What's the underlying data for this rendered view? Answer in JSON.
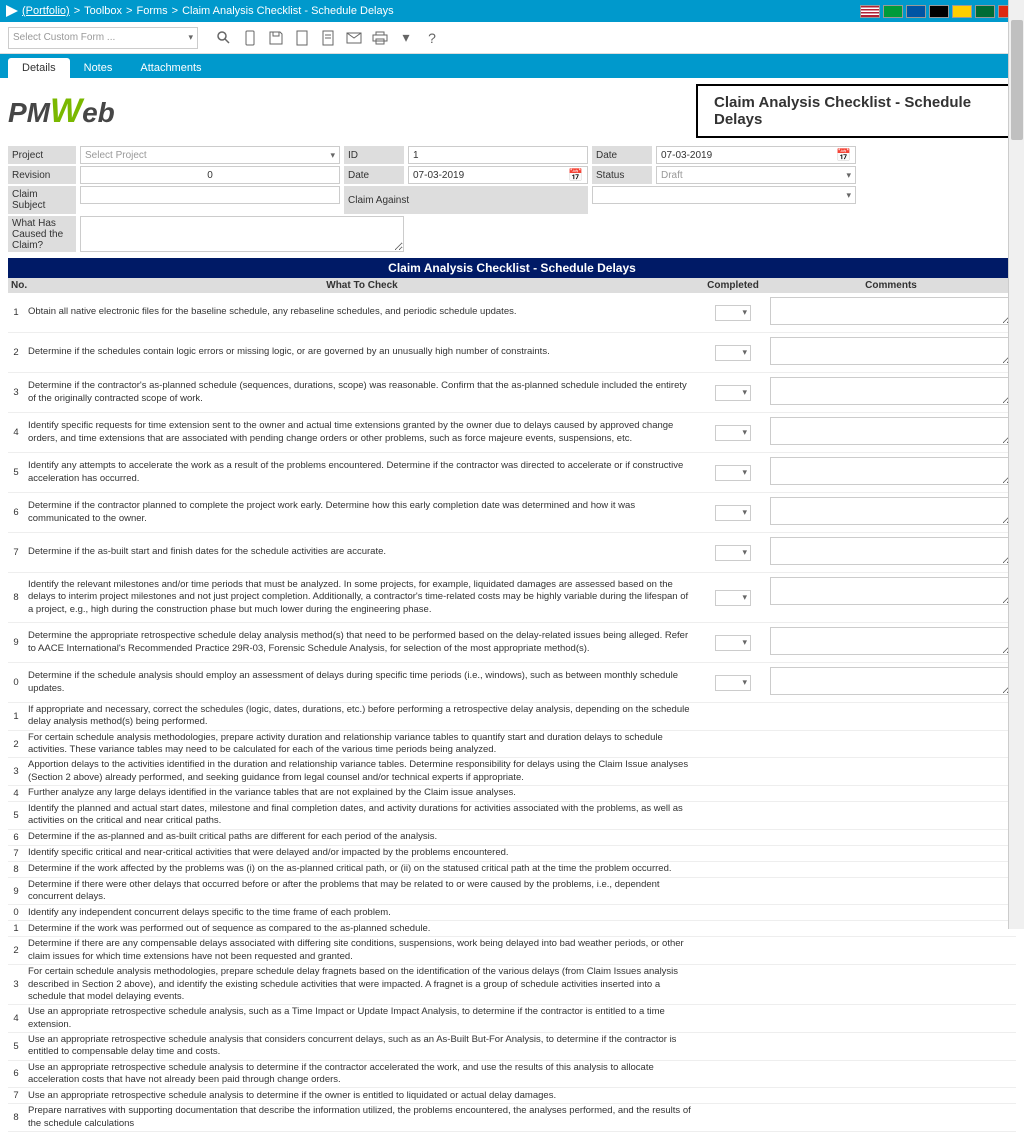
{
  "breadcrumb": {
    "portfolio": "(Portfolio)",
    "sep": ">",
    "toolbox": "Toolbox",
    "forms": "Forms",
    "current": "Claim Analysis Checklist - Schedule Delays"
  },
  "custom_form_placeholder": "Select Custom Form ...",
  "tabs": {
    "details": "Details",
    "notes": "Notes",
    "attachments": "Attachments"
  },
  "logo": {
    "pm": "PM",
    "w": "W",
    "eb": "eb"
  },
  "page_title": "Claim Analysis Checklist - Schedule Delays",
  "form": {
    "project_label": "Project",
    "project_value": "Select Project",
    "revision_label": "Revision",
    "revision_value": "0",
    "claim_subject_label": "Claim Subject",
    "what_caused_label": "What Has Caused the Claim?",
    "id_label": "ID",
    "id_value": "1",
    "date_label": "Date",
    "date_value": "07-03-2019",
    "date2_label": "Date",
    "date2_value": "07-03-2019",
    "claim_against_label": "Claim Against",
    "status_label": "Status",
    "status_value": "Draft"
  },
  "section_title": "Claim Analysis Checklist - Schedule Delays",
  "columns": {
    "no": "No.",
    "what": "What To Check",
    "completed": "Completed",
    "comments": "Comments"
  },
  "rows": [
    {
      "no": "1",
      "text": "Obtain all native electronic files for the baseline schedule, any rebaseline schedules, and periodic schedule updates.",
      "dd": true,
      "cm": true
    },
    {
      "no": "2",
      "text": "Determine if the schedules contain logic errors or missing logic, or are governed by an unusually high number of constraints.",
      "dd": true,
      "cm": true
    },
    {
      "no": "3",
      "text": "Determine if the contractor's as-planned schedule (sequences, durations, scope) was reasonable. Confirm that the as-planned schedule included the entirety of the originally contracted scope of work.",
      "dd": true,
      "cm": true
    },
    {
      "no": "4",
      "text": "Identify specific requests for time extension sent to the owner and actual time extensions granted by the owner due to delays caused by approved change orders, and time extensions that are associated with pending change orders or other problems, such as force majeure events, suspensions, etc.",
      "dd": true,
      "cm": true
    },
    {
      "no": "5",
      "text": "Identify any attempts to accelerate the work as a result of the problems encountered. Determine if the contractor was directed to accelerate or if constructive acceleration has occurred.",
      "dd": true,
      "cm": true
    },
    {
      "no": "6",
      "text": "Determine if the contractor planned to complete the project work early. Determine how this early completion date was determined and how it was communicated to the owner.",
      "dd": true,
      "cm": true
    },
    {
      "no": "7",
      "text": "Determine if the as-built start and finish dates for the schedule activities are accurate.",
      "dd": true,
      "cm": true
    },
    {
      "no": "8",
      "text": "Identify the relevant milestones and/or time periods that must be analyzed. In some projects, for example, liquidated damages are assessed based on the delays to interim project milestones and not just project completion. Additionally, a contractor's time-related costs may be highly variable during the lifespan of a project, e.g., high during the construction phase but much lower during the engineering phase.",
      "dd": true,
      "cm": true
    },
    {
      "no": "9",
      "text": "Determine the appropriate retrospective schedule delay analysis method(s) that need to be performed based on the delay-related issues being alleged. Refer to AACE International's Recommended Practice 29R-03, Forensic Schedule Analysis, for selection of the most appropriate method(s).",
      "dd": true,
      "cm": true
    },
    {
      "no": "0",
      "text": "Determine if the schedule analysis should employ an assessment of delays during specific time periods (i.e., windows), such as between monthly schedule updates.",
      "dd": true,
      "cm": true
    },
    {
      "no": "1",
      "text": "If appropriate and necessary, correct the schedules (logic, dates, durations, etc.) before performing a retrospective delay analysis, depending on the schedule delay analysis method(s) being performed.",
      "compact": true
    },
    {
      "no": "2",
      "text": "For certain schedule analysis methodologies, prepare activity duration and relationship variance tables to quantify start and duration delays to schedule activities. These variance tables may need to be calculated for each of the various time periods being analyzed.",
      "compact": true
    },
    {
      "no": "3",
      "text": "Apportion delays to the activities identified in the duration and relationship variance tables. Determine responsibility for delays using the Claim Issue analyses (Section 2 above) already performed, and seeking guidance from legal counsel and/or technical experts if appropriate.",
      "compact": true
    },
    {
      "no": "4",
      "text": "Further analyze any large delays identified in the variance tables that are not explained by the Claim issue analyses.",
      "compact": true
    },
    {
      "no": "5",
      "text": "Identify the planned and actual start dates, milestone and final completion dates, and activity durations for activities associated with the problems, as well as activities on the critical and near critical paths.",
      "compact": true
    },
    {
      "no": "6",
      "text": "Determine if the as-planned and as-built critical paths are different for each period of the analysis.",
      "compact": true
    },
    {
      "no": "7",
      "text": "Identify specific critical and near-critical activities that were delayed and/or impacted by the problems encountered.",
      "compact": true
    },
    {
      "no": "8",
      "text": "Determine if the work affected by the problems was (i) on the as-planned critical path, or (ii) on the statused critical path at the time the problem occurred.",
      "compact": true
    },
    {
      "no": "9",
      "text": "Determine if there were other delays that occurred before or after the problems that may be related to or were caused by the problems, i.e., dependent concurrent delays.",
      "compact": true
    },
    {
      "no": "0",
      "text": "Identify any independent concurrent delays specific to the time frame of each problem.",
      "compact": true
    },
    {
      "no": "1",
      "text": "Determine if the work was performed out of sequence as compared to the as-planned schedule.",
      "compact": true
    },
    {
      "no": "2",
      "text": "Determine if there are any compensable delays associated with differing site conditions, suspensions, work being delayed into bad weather periods, or other claim issues for which time extensions have not been requested and granted.",
      "compact": true
    },
    {
      "no": "3",
      "text": "For certain schedule analysis methodologies, prepare schedule delay fragnets based on the identification of the various delays (from Claim Issues analysis described in Section 2 above), and identify the existing schedule activities that were impacted. A fragnet is a group of schedule activities inserted into a schedule that model delaying events.",
      "compact": true
    },
    {
      "no": "4",
      "text": "Use an appropriate retrospective schedule analysis, such as a Time Impact or Update Impact Analysis, to determine if the contractor is entitled to a time extension.",
      "compact": true
    },
    {
      "no": "5",
      "text": "Use an appropriate retrospective schedule analysis that considers concurrent delays, such as an As-Built But-For Analysis, to determine if the contractor is entitled to compensable delay time and costs.",
      "compact": true
    },
    {
      "no": "6",
      "text": "Use an appropriate retrospective schedule analysis to determine if the contractor accelerated the work, and use the results of this analysis to allocate acceleration costs that have not already been paid through change orders.",
      "compact": true
    },
    {
      "no": "7",
      "text": "Use an appropriate retrospective schedule analysis to determine if the owner is entitled to liquidated or actual delay damages.",
      "compact": true
    },
    {
      "no": "8",
      "text": "Prepare narratives with supporting documentation that describe the information utilized, the problems encountered, the analyses performed, and the results of the schedule calculations",
      "compact": true
    }
  ],
  "flag_colors": [
    "linear-gradient(to bottom,#b22234 14%,#fff 14% 28%,#b22234 28% 42%,#fff 42% 56%,#b22234 56% 70%,#fff 70% 84%,#b22234 84%)",
    "#009b3a",
    "#0055a4",
    "#000",
    "#ffce00",
    "#006c35",
    "#de2910"
  ]
}
